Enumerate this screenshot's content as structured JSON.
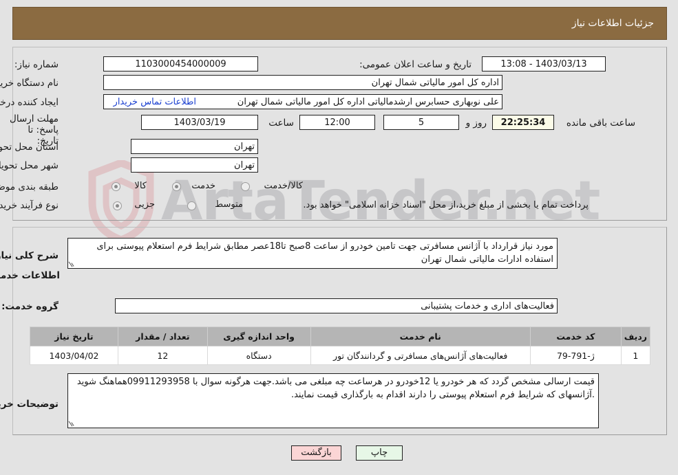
{
  "header": {
    "title": "جزئیات اطلاعات نیاز",
    "bar_color": "#8b6b41"
  },
  "watermark": {
    "brand": "ArtaTender",
    "domain": ".net"
  },
  "info": {
    "need_number_label": "شماره نیاز:",
    "need_number_value": "1103000454000009",
    "announce_datetime_label": "تاریخ و ساعت اعلان عمومی:",
    "announce_datetime_value": "1403/03/13 - 13:08",
    "buyer_org_label": "نام دستگاه خریدار:",
    "buyer_org_value": "اداره کل امور مالیاتی شمال تهران",
    "requester_label": "ایجاد کننده درخواست:",
    "requester_value": "علی نوبهاری حسابرس ارشدمالیاتی اداره کل امور مالیاتی شمال تهران",
    "contact_link": "اطلاعات تماس خریدار",
    "deadline_label": "مهلت ارسال پاسخ: تا تاریخ:",
    "deadline_date": "1403/03/19",
    "hour_label": "ساعت",
    "deadline_hour": "12:00",
    "days_value": "5",
    "days_label": "روز و",
    "remaining_time": "22:25:34",
    "remaining_label": "ساعت باقی مانده",
    "province_label": "استان محل تحویل:",
    "province_value": "تهران",
    "city_label": "شهر محل تحویل:",
    "city_value": "تهران",
    "category_label": "طبقه بندی موضوعی:",
    "category_options": [
      {
        "label": "کالا",
        "selected": false
      },
      {
        "label": "خدمت",
        "selected": true
      },
      {
        "label": "کالا/خدمت",
        "selected": false
      }
    ],
    "process_label": "نوع فرآیند خرید :",
    "process_options": [
      {
        "label": "جزیی",
        "selected": true
      },
      {
        "label": "متوسط",
        "selected": false
      }
    ],
    "treasury_note": "پرداخت تمام یا بخشی از مبلغ خرید،از محل \"اسناد خزانه اسلامی\" خواهد بود."
  },
  "summary": {
    "label": "شرح کلی نیاز:",
    "value": "مورد نیاز قرارداد با آژانس مسافرتی جهت تامین  خودرو  از ساعت 8صبح تا18عصر مطابق شرایط فرم استعلام پیوستی برای استفاده ادارات مالیاتی شمال تهران"
  },
  "services_section": {
    "heading": "اطلاعات خدمات مورد نیاز",
    "group_label": "گروه خدمت:",
    "group_value": "فعالیت‌های اداری و خدمات پشتیبانی"
  },
  "table": {
    "columns": [
      "ردیف",
      "کد خدمت",
      "نام خدمت",
      "واحد اندازه گیری",
      "تعداد / مقدار",
      "تاریخ نیاز"
    ],
    "rows": [
      {
        "radif": "1",
        "code": "ژ-791-79",
        "name": "فعالیت‌های آژانس‌های مسافرتی و گردانندگان تور",
        "unit": "دستگاه",
        "qty": "12",
        "date": "1403/04/02"
      }
    ]
  },
  "buyer_notes": {
    "label": "توضیحات خریدار:",
    "value": "قیمت ارسالی مشخص گردد که هر خودرو یا 12خودرو در هرساعت چه مبلغی می باشد.جهت هرگونه سوال با 09911293958هماهنگ شوید .آژانسهای که شرایط فرم استعلام پیوستی را دارند اقدام به بارگذاری قیمت نمایند."
  },
  "footer": {
    "print_label": "چاپ",
    "back_label": "بازگشت"
  }
}
